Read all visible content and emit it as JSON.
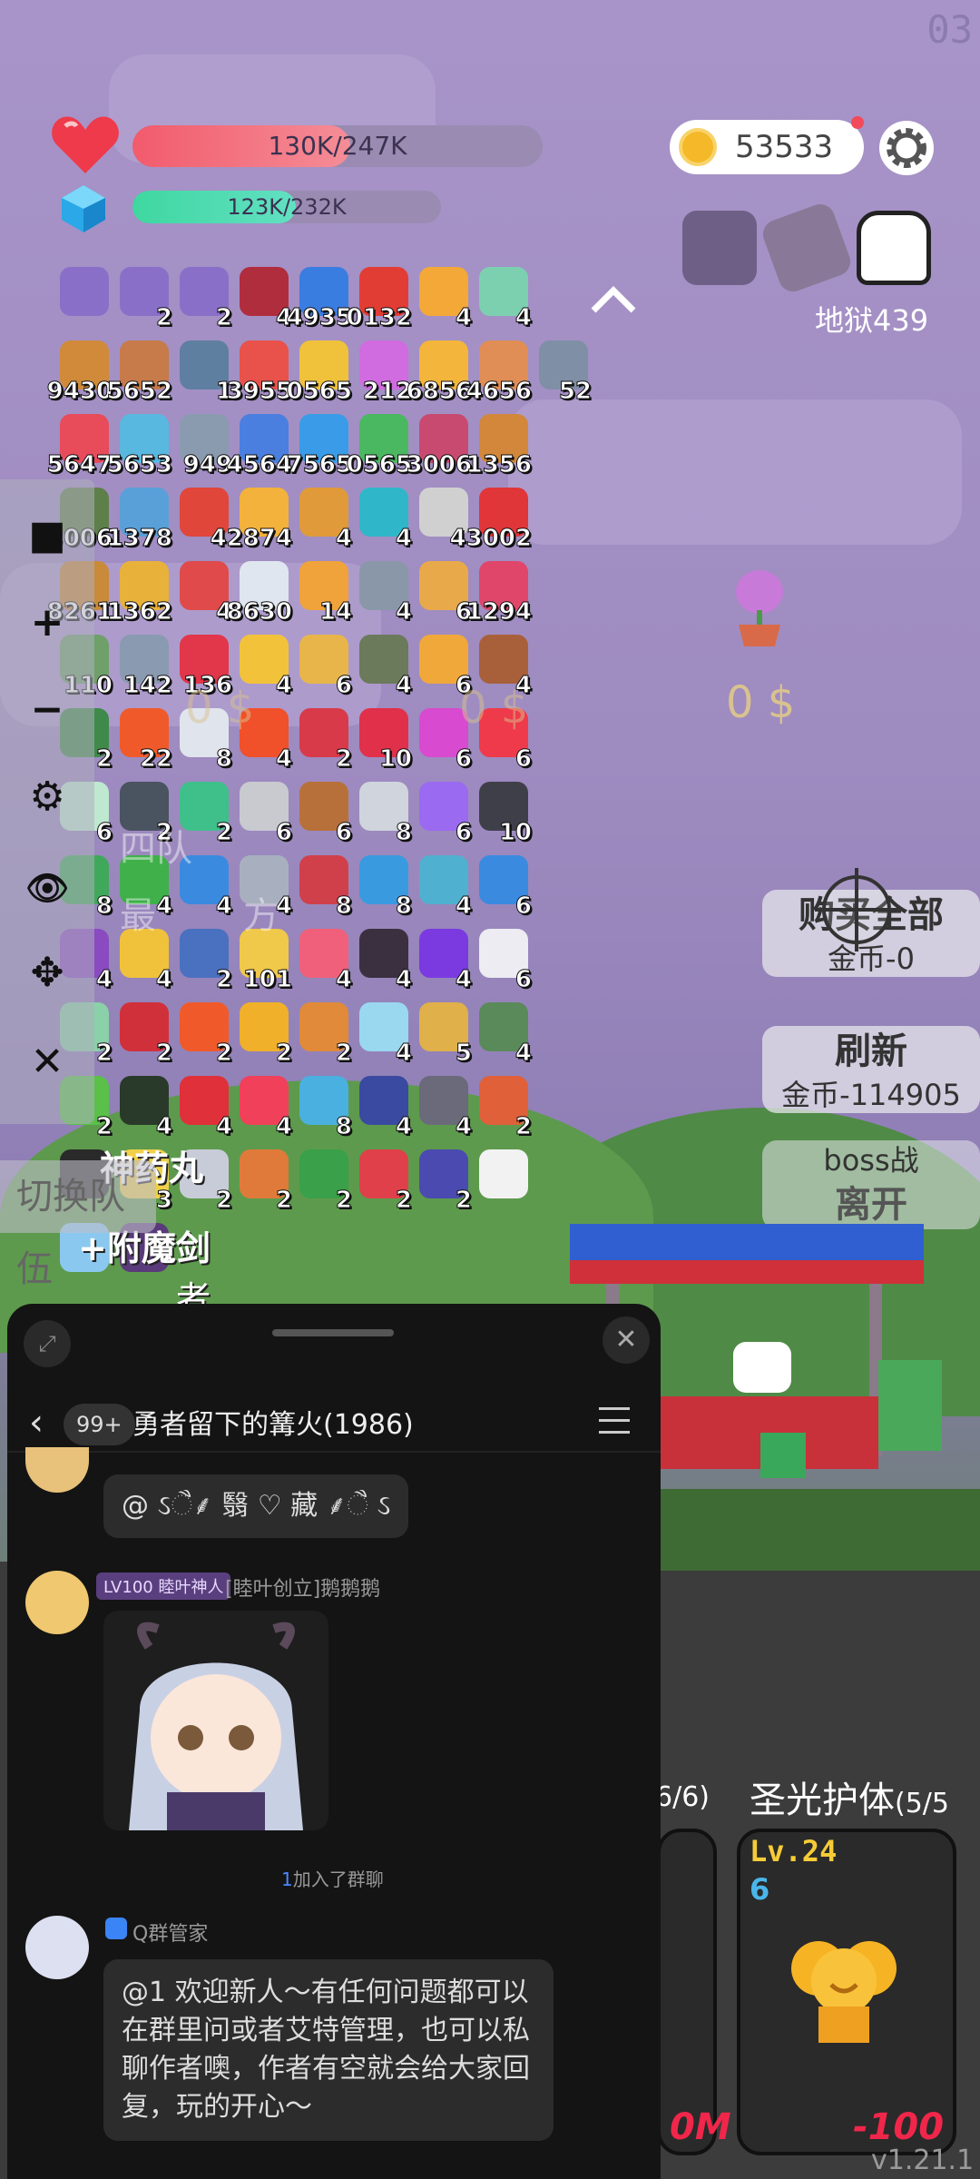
{
  "hud": {
    "top_number": "03",
    "hp_text": "130K/247K",
    "hp_fraction": 0.53,
    "mp_text": "123K/232K",
    "mp_fraction": 0.53,
    "coins": "53533",
    "hell_level": "地狱439"
  },
  "inventory": [
    {
      "icon": "note-card-icon",
      "count": "",
      "color": "#8a6fc9"
    },
    {
      "icon": "note-card-icon",
      "count": "2",
      "color": "#8a6fc9"
    },
    {
      "icon": "note-card-icon",
      "count": "2",
      "color": "#8a6fc9"
    },
    {
      "icon": "demon-mask-icon",
      "count": "4",
      "color": "#b02d3e"
    },
    {
      "icon": "star-ticket-icon",
      "count": "4935",
      "color": "#3a7de0"
    },
    {
      "icon": "apple-icon",
      "count": "0132",
      "color": "#e23d35"
    },
    {
      "icon": "flag-icon",
      "count": "4",
      "color": "#f3a838"
    },
    {
      "icon": "ice-cream-icon",
      "count": "4",
      "color": "#7cd0b0"
    },
    {
      "icon": "spacer",
      "count": "",
      "color": "transparent"
    },
    {
      "icon": "book-icon",
      "count": "9430",
      "color": "#d08a3a"
    },
    {
      "icon": "donut-icon",
      "count": "5652",
      "color": "#c77a4a"
    },
    {
      "icon": "dagger-icon",
      "count": "1",
      "color": "#5f7fa0"
    },
    {
      "icon": "watermelon-icon",
      "count": "3955",
      "color": "#e8524a"
    },
    {
      "icon": "flower-icon",
      "count": "0565",
      "color": "#f0c23b"
    },
    {
      "icon": "mushroom-icon",
      "count": "212",
      "color": "#d06be0"
    },
    {
      "icon": "beer-icon",
      "count": "6856",
      "color": "#f3b53b"
    },
    {
      "icon": "scroll-icon",
      "count": "4656",
      "color": "#e08e55"
    },
    {
      "icon": "sword-icon",
      "count": "52",
      "color": "#7f8fa6"
    },
    {
      "icon": "pill-icon",
      "count": "5647",
      "color": "#e84b5a"
    },
    {
      "icon": "potion-icon",
      "count": "5653",
      "color": "#58b8e0"
    },
    {
      "icon": "blade-icon",
      "count": "949",
      "color": "#8a9bb0"
    },
    {
      "icon": "crystal-icon",
      "count": "4564",
      "color": "#4a7fe0"
    },
    {
      "icon": "chat-bubble-icon",
      "count": "7565",
      "color": "#3a9ce8"
    },
    {
      "icon": "cactus-icon",
      "count": "0565",
      "color": "#4ab860"
    },
    {
      "icon": "staff-icon",
      "count": "3006",
      "color": "#c94a70"
    },
    {
      "icon": "sword-flame-icon",
      "count": "1356",
      "color": "#d2873a"
    },
    {
      "icon": "spacer",
      "count": "",
      "color": "transparent"
    },
    {
      "icon": "shield-icon",
      "count": "3006",
      "color": "#5f7f4a"
    },
    {
      "icon": "armor-icon",
      "count": "1378",
      "color": "#5aa0d8"
    },
    {
      "icon": "heat-wave-icon",
      "count": "",
      "color": "#e0463a"
    },
    {
      "icon": "sunflower-icon",
      "count": "42874",
      "color": "#f3b23b"
    },
    {
      "icon": "briefcase-icon",
      "count": "4",
      "color": "#e09a3a"
    },
    {
      "icon": "spiral-icon",
      "count": "4",
      "color": "#2fb6c9"
    },
    {
      "icon": "cards-icon",
      "count": "",
      "color": "#d0d0d0"
    },
    {
      "icon": "red-card-icon",
      "count": "43002",
      "color": "#e0363a"
    },
    {
      "icon": "spacer",
      "count": "",
      "color": "transparent"
    },
    {
      "icon": "bow-icon",
      "count": "8261",
      "color": "#c98a3a"
    },
    {
      "icon": "pineapple-icon",
      "count": "1362",
      "color": "#e8b23a"
    },
    {
      "icon": "melon-slice-icon",
      "count": "4",
      "color": "#e04a4a"
    },
    {
      "icon": "envelope-icon",
      "count": "8630",
      "color": "#dfe6f0"
    },
    {
      "icon": "pineapple-small-icon",
      "count": "14",
      "color": "#f0a33a"
    },
    {
      "icon": "compass-icon",
      "count": "4",
      "color": "#8a97a8"
    },
    {
      "icon": "parchment-icon",
      "count": "6",
      "color": "#e8a94a"
    },
    {
      "icon": "jam-jar-icon",
      "count": "1294",
      "color": "#e0466a"
    },
    {
      "icon": "spacer",
      "count": "",
      "color": "transparent"
    },
    {
      "icon": "egg-icon",
      "count": "110",
      "color": "#6fa06a"
    },
    {
      "icon": "elephant-icon",
      "count": "142",
      "color": "#8a9ab0"
    },
    {
      "icon": "strawberry-icon",
      "count": "136",
      "color": "#e2364a"
    },
    {
      "icon": "sun-icon",
      "count": "4",
      "color": "#f3c23b"
    },
    {
      "icon": "map-scroll-icon",
      "count": "6",
      "color": "#e8b54a"
    },
    {
      "icon": "mortar-icon",
      "count": "4",
      "color": "#6a7a5a"
    },
    {
      "icon": "recipe-icon",
      "count": "6",
      "color": "#f0a83a"
    },
    {
      "icon": "acorn-icon",
      "count": "4",
      "color": "#a8603a"
    },
    {
      "icon": "spacer",
      "count": "",
      "color": "transparent"
    },
    {
      "icon": "green-sword-icon",
      "count": "2",
      "color": "#3f8a4a"
    },
    {
      "icon": "fire-ball-icon",
      "count": "22",
      "color": "#f05a2a"
    },
    {
      "icon": "list-icon",
      "count": "8",
      "color": "#e0e4ec"
    },
    {
      "icon": "flame-ring-icon",
      "count": "4",
      "color": "#f0502a"
    },
    {
      "icon": "shield-red-icon",
      "count": "2",
      "color": "#d83a4a"
    },
    {
      "icon": "ruby-icon",
      "count": "10",
      "color": "#e0304a"
    },
    {
      "icon": "beads-icon",
      "count": "6",
      "color": "#d84ad0"
    },
    {
      "icon": "heart-icon",
      "count": "6",
      "color": "#ee3a4a"
    },
    {
      "icon": "spacer",
      "count": "",
      "color": "transparent"
    },
    {
      "icon": "ghost-icon",
      "count": "6",
      "color": "#bfe8d0"
    },
    {
      "icon": "bomb-icon",
      "count": "2",
      "color": "#4a5360"
    },
    {
      "icon": "jade-icon",
      "count": "2",
      "color": "#3fbf8a"
    },
    {
      "icon": "hook-icon",
      "count": "6",
      "color": "#c8cad0"
    },
    {
      "icon": "drumstick-icon",
      "count": "6",
      "color": "#b8703a"
    },
    {
      "icon": "hammer-icon",
      "count": "8",
      "color": "#d0d4dc"
    },
    {
      "icon": "magic-wand-icon",
      "count": "6",
      "color": "#9a6af0"
    },
    {
      "icon": "cauldron-icon",
      "count": "10",
      "color": "#3f3f4a"
    },
    {
      "icon": "spacer",
      "count": "",
      "color": "transparent"
    },
    {
      "icon": "teacup-icon",
      "count": "8",
      "color": "#3fa85a"
    },
    {
      "icon": "green-book-icon",
      "count": "4",
      "color": "#3fb04a"
    },
    {
      "icon": "wings-icon",
      "count": "4",
      "color": "#3a8ae0"
    },
    {
      "icon": "crossed-swords-icon",
      "count": "4",
      "color": "#a8b0c0"
    },
    {
      "icon": "mushrooms-icon",
      "count": "8",
      "color": "#d0404a"
    },
    {
      "icon": "blue-scroll-icon",
      "count": "8",
      "color": "#3a9ae0"
    },
    {
      "icon": "pin-icon",
      "count": "4",
      "color": "#50b0d0"
    },
    {
      "icon": "target-icon",
      "count": "6",
      "color": "#3a8ae0"
    },
    {
      "icon": "spacer",
      "count": "",
      "color": "transparent"
    },
    {
      "icon": "purple-potion-icon",
      "count": "4",
      "color": "#8a4ac0"
    },
    {
      "icon": "pencil-note-icon",
      "count": "4",
      "color": "#f0c23b"
    },
    {
      "icon": "cloak-icon",
      "count": "2",
      "color": "#4a70c0"
    },
    {
      "icon": "map-icon",
      "count": "101",
      "color": "#f0c84a"
    },
    {
      "icon": "calendar-icon",
      "count": "4",
      "color": "#f0607a"
    },
    {
      "icon": "bat-icon",
      "count": "4",
      "color": "#3a3040"
    },
    {
      "icon": "orb-icon",
      "count": "4",
      "color": "#7a3ae0"
    },
    {
      "icon": "speech-icon",
      "count": "6",
      "color": "#ececf2"
    },
    {
      "icon": "spacer",
      "count": "",
      "color": "transparent"
    },
    {
      "icon": "bulb-icon",
      "count": "2",
      "color": "#8ad0a8"
    },
    {
      "icon": "magnet-icon",
      "count": "2",
      "color": "#d0303a"
    },
    {
      "icon": "fire-icon",
      "count": "2",
      "color": "#f05a2a"
    },
    {
      "icon": "star-wand-icon",
      "count": "2",
      "color": "#f0b02a"
    },
    {
      "icon": "tools-icon",
      "count": "2",
      "color": "#e08a3a"
    },
    {
      "icon": "frame-icon",
      "count": "4",
      "color": "#9ad8f0"
    },
    {
      "icon": "treasure-map-icon",
      "count": "5",
      "color": "#e0b04a"
    },
    {
      "icon": "zombie-icon",
      "count": "4",
      "color": "#5a8a5a"
    },
    {
      "icon": "spacer",
      "count": "",
      "color": "transparent"
    },
    {
      "icon": "lime-icon",
      "count": "2",
      "color": "#5ac04a"
    },
    {
      "icon": "eye-icon",
      "count": "4",
      "color": "#2a3a2a"
    },
    {
      "icon": "location-pin-icon",
      "count": "4",
      "color": "#e0303a"
    },
    {
      "icon": "flame-drop-icon",
      "count": "4",
      "color": "#f0405a"
    },
    {
      "icon": "bubble-potion-icon",
      "count": "8",
      "color": "#4ab0e0"
    },
    {
      "icon": "bible-icon",
      "count": "4",
      "color": "#3a4aa0"
    },
    {
      "icon": "mace-icon",
      "count": "4",
      "color": "#6a6a7a"
    },
    {
      "icon": "crown-icon",
      "count": "2",
      "color": "#e0603a"
    },
    {
      "icon": "spacer",
      "count": "",
      "color": "transparent"
    },
    {
      "icon": "hand-icon",
      "count": "",
      "color": "#2a2a2a"
    },
    {
      "icon": "question-book-icon",
      "count": "3",
      "color": "#f0d04a"
    },
    {
      "icon": "swirl-icon",
      "count": "2",
      "color": "#c8ccd8"
    },
    {
      "icon": "goblet-icon",
      "count": "2",
      "color": "#e07a3a"
    },
    {
      "icon": "snake-icon",
      "count": "2",
      "color": "#3aa04a"
    },
    {
      "icon": "red-shield-icon",
      "count": "2",
      "color": "#e0404a"
    },
    {
      "icon": "star-box-icon",
      "count": "2",
      "color": "#4a4ab0"
    },
    {
      "icon": "dice-icon",
      "count": "",
      "color": "#f2f2f2"
    },
    {
      "icon": "spacer",
      "count": "",
      "color": "transparent"
    },
    {
      "icon": "mirror-icon",
      "count": "",
      "color": "#8ac8f0"
    },
    {
      "icon": "dark-face-icon",
      "count": "",
      "color": "#5a3a7a"
    }
  ],
  "sidebar": {
    "overlay_text_1": "四队",
    "overlay_text_2": "最",
    "overlay_text_3": "方"
  },
  "overlays": {
    "skill_text_1": "神药丸",
    "skill_text_2": "+附魔剑",
    "skill_text_3": "者"
  },
  "shop": {
    "dollar_1": "0 $",
    "dollar_2": "0 $",
    "dollar_3": "0 $",
    "buy_all_title": "购买全部",
    "buy_all_sub": "金币-0",
    "refresh_title": "刷新",
    "refresh_sub": "金币-114905",
    "boss_title": "boss战",
    "leave_title": "离开",
    "switch_text": "切换队伍"
  },
  "cards": {
    "left_progress": "6/6)",
    "title": "圣光护体",
    "title_count": "(5/5",
    "level": "Lv.24",
    "level_value": "6",
    "cost_left": "0M",
    "cost_right": "-100",
    "version": "v1.21.1"
  },
  "chat": {
    "unread": "99+",
    "group_name": "勇者留下的篝火(1986)",
    "msg1": "@ ઽૈ⸙ 翳 ♡ 藏 ⸙ૈ ઽ",
    "user_level": "LV100 睦叶神人",
    "user_name": "[睦叶创立]鹅鹅鹅",
    "join_user": "1",
    "join_text": "加入了群聊",
    "bot_name": "Q群管家",
    "bot_msg": "@1 欢迎新人～有任何问题都可以在群里问或者艾特管理，也可以私聊作者噢，作者有空就会给大家回复，玩的开心～"
  }
}
